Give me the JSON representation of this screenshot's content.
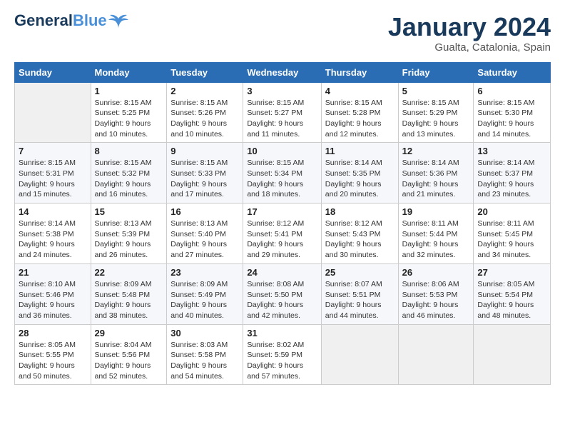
{
  "header": {
    "logo_general": "General",
    "logo_blue": "Blue",
    "month_title": "January 2024",
    "location": "Gualta, Catalonia, Spain"
  },
  "days_of_week": [
    "Sunday",
    "Monday",
    "Tuesday",
    "Wednesday",
    "Thursday",
    "Friday",
    "Saturday"
  ],
  "weeks": [
    [
      {
        "day": "",
        "sunrise": "",
        "sunset": "",
        "daylight": ""
      },
      {
        "day": "1",
        "sunrise": "Sunrise: 8:15 AM",
        "sunset": "Sunset: 5:25 PM",
        "daylight": "Daylight: 9 hours and 10 minutes."
      },
      {
        "day": "2",
        "sunrise": "Sunrise: 8:15 AM",
        "sunset": "Sunset: 5:26 PM",
        "daylight": "Daylight: 9 hours and 10 minutes."
      },
      {
        "day": "3",
        "sunrise": "Sunrise: 8:15 AM",
        "sunset": "Sunset: 5:27 PM",
        "daylight": "Daylight: 9 hours and 11 minutes."
      },
      {
        "day": "4",
        "sunrise": "Sunrise: 8:15 AM",
        "sunset": "Sunset: 5:28 PM",
        "daylight": "Daylight: 9 hours and 12 minutes."
      },
      {
        "day": "5",
        "sunrise": "Sunrise: 8:15 AM",
        "sunset": "Sunset: 5:29 PM",
        "daylight": "Daylight: 9 hours and 13 minutes."
      },
      {
        "day": "6",
        "sunrise": "Sunrise: 8:15 AM",
        "sunset": "Sunset: 5:30 PM",
        "daylight": "Daylight: 9 hours and 14 minutes."
      }
    ],
    [
      {
        "day": "7",
        "sunrise": "Sunrise: 8:15 AM",
        "sunset": "Sunset: 5:31 PM",
        "daylight": "Daylight: 9 hours and 15 minutes."
      },
      {
        "day": "8",
        "sunrise": "Sunrise: 8:15 AM",
        "sunset": "Sunset: 5:32 PM",
        "daylight": "Daylight: 9 hours and 16 minutes."
      },
      {
        "day": "9",
        "sunrise": "Sunrise: 8:15 AM",
        "sunset": "Sunset: 5:33 PM",
        "daylight": "Daylight: 9 hours and 17 minutes."
      },
      {
        "day": "10",
        "sunrise": "Sunrise: 8:15 AM",
        "sunset": "Sunset: 5:34 PM",
        "daylight": "Daylight: 9 hours and 18 minutes."
      },
      {
        "day": "11",
        "sunrise": "Sunrise: 8:14 AM",
        "sunset": "Sunset: 5:35 PM",
        "daylight": "Daylight: 9 hours and 20 minutes."
      },
      {
        "day": "12",
        "sunrise": "Sunrise: 8:14 AM",
        "sunset": "Sunset: 5:36 PM",
        "daylight": "Daylight: 9 hours and 21 minutes."
      },
      {
        "day": "13",
        "sunrise": "Sunrise: 8:14 AM",
        "sunset": "Sunset: 5:37 PM",
        "daylight": "Daylight: 9 hours and 23 minutes."
      }
    ],
    [
      {
        "day": "14",
        "sunrise": "Sunrise: 8:14 AM",
        "sunset": "Sunset: 5:38 PM",
        "daylight": "Daylight: 9 hours and 24 minutes."
      },
      {
        "day": "15",
        "sunrise": "Sunrise: 8:13 AM",
        "sunset": "Sunset: 5:39 PM",
        "daylight": "Daylight: 9 hours and 26 minutes."
      },
      {
        "day": "16",
        "sunrise": "Sunrise: 8:13 AM",
        "sunset": "Sunset: 5:40 PM",
        "daylight": "Daylight: 9 hours and 27 minutes."
      },
      {
        "day": "17",
        "sunrise": "Sunrise: 8:12 AM",
        "sunset": "Sunset: 5:41 PM",
        "daylight": "Daylight: 9 hours and 29 minutes."
      },
      {
        "day": "18",
        "sunrise": "Sunrise: 8:12 AM",
        "sunset": "Sunset: 5:43 PM",
        "daylight": "Daylight: 9 hours and 30 minutes."
      },
      {
        "day": "19",
        "sunrise": "Sunrise: 8:11 AM",
        "sunset": "Sunset: 5:44 PM",
        "daylight": "Daylight: 9 hours and 32 minutes."
      },
      {
        "day": "20",
        "sunrise": "Sunrise: 8:11 AM",
        "sunset": "Sunset: 5:45 PM",
        "daylight": "Daylight: 9 hours and 34 minutes."
      }
    ],
    [
      {
        "day": "21",
        "sunrise": "Sunrise: 8:10 AM",
        "sunset": "Sunset: 5:46 PM",
        "daylight": "Daylight: 9 hours and 36 minutes."
      },
      {
        "day": "22",
        "sunrise": "Sunrise: 8:09 AM",
        "sunset": "Sunset: 5:48 PM",
        "daylight": "Daylight: 9 hours and 38 minutes."
      },
      {
        "day": "23",
        "sunrise": "Sunrise: 8:09 AM",
        "sunset": "Sunset: 5:49 PM",
        "daylight": "Daylight: 9 hours and 40 minutes."
      },
      {
        "day": "24",
        "sunrise": "Sunrise: 8:08 AM",
        "sunset": "Sunset: 5:50 PM",
        "daylight": "Daylight: 9 hours and 42 minutes."
      },
      {
        "day": "25",
        "sunrise": "Sunrise: 8:07 AM",
        "sunset": "Sunset: 5:51 PM",
        "daylight": "Daylight: 9 hours and 44 minutes."
      },
      {
        "day": "26",
        "sunrise": "Sunrise: 8:06 AM",
        "sunset": "Sunset: 5:53 PM",
        "daylight": "Daylight: 9 hours and 46 minutes."
      },
      {
        "day": "27",
        "sunrise": "Sunrise: 8:05 AM",
        "sunset": "Sunset: 5:54 PM",
        "daylight": "Daylight: 9 hours and 48 minutes."
      }
    ],
    [
      {
        "day": "28",
        "sunrise": "Sunrise: 8:05 AM",
        "sunset": "Sunset: 5:55 PM",
        "daylight": "Daylight: 9 hours and 50 minutes."
      },
      {
        "day": "29",
        "sunrise": "Sunrise: 8:04 AM",
        "sunset": "Sunset: 5:56 PM",
        "daylight": "Daylight: 9 hours and 52 minutes."
      },
      {
        "day": "30",
        "sunrise": "Sunrise: 8:03 AM",
        "sunset": "Sunset: 5:58 PM",
        "daylight": "Daylight: 9 hours and 54 minutes."
      },
      {
        "day": "31",
        "sunrise": "Sunrise: 8:02 AM",
        "sunset": "Sunset: 5:59 PM",
        "daylight": "Daylight: 9 hours and 57 minutes."
      },
      {
        "day": "",
        "sunrise": "",
        "sunset": "",
        "daylight": ""
      },
      {
        "day": "",
        "sunrise": "",
        "sunset": "",
        "daylight": ""
      },
      {
        "day": "",
        "sunrise": "",
        "sunset": "",
        "daylight": ""
      }
    ]
  ]
}
